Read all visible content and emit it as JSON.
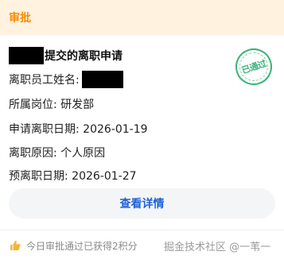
{
  "header": {
    "title": "审批",
    "accent_color": "#ff8a00",
    "bg_color": "#fff3e0"
  },
  "card": {
    "title_suffix": "提交的离职申请",
    "fields": {
      "employee_name_label": "离职员工姓名:",
      "position": "所属岗位: 研发部",
      "apply_date": "申请离职日期: 2026-01-19",
      "reason": "离职原因: 个人原因",
      "planned_date": "预离职日期: 2026-01-27"
    },
    "stamp": {
      "text": "已通过",
      "color": "#3cb37a"
    },
    "detail_button": {
      "label": "查看详情",
      "color": "#1e63d6"
    }
  },
  "footer": {
    "icon": "thumbs-up-icon",
    "text": "今日审批通过已获得2积分",
    "watermark": "掘金技术社区 @一苇一"
  }
}
